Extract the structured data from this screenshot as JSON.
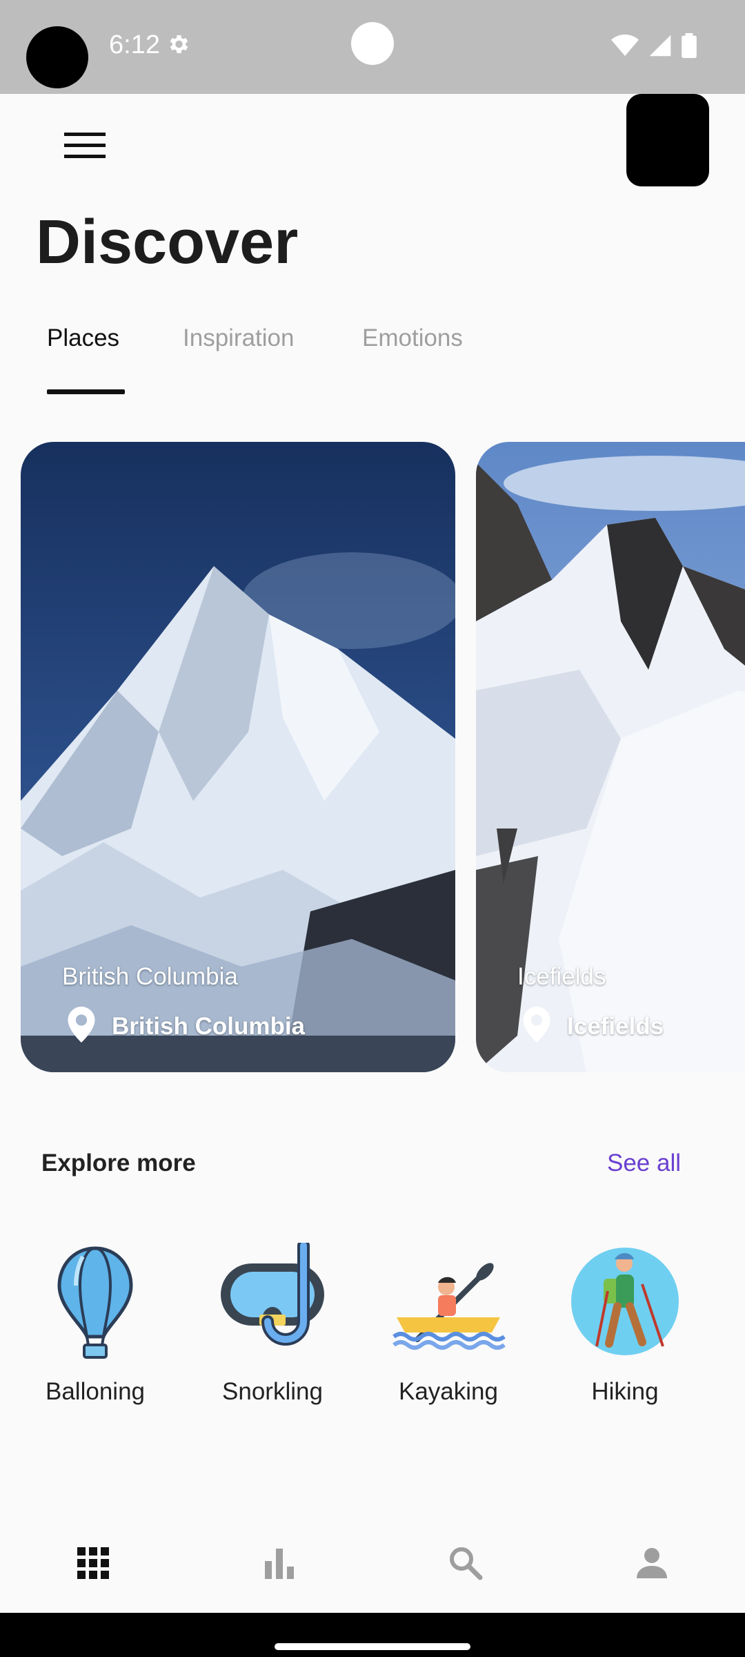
{
  "status_bar": {
    "time": "6:12",
    "icons": [
      "settings-icon",
      "wifi-icon",
      "signal-icon",
      "battery-icon"
    ]
  },
  "header": {
    "title": "Discover",
    "menu_icon": "menu-icon"
  },
  "tabs": [
    {
      "label": "Places",
      "active": true
    },
    {
      "label": "Inspiration",
      "active": false
    },
    {
      "label": "Emotions",
      "active": false
    }
  ],
  "cards": [
    {
      "title": "British Columbia",
      "location": "British Columbia"
    },
    {
      "title": "Icefields",
      "location": "Icefields"
    }
  ],
  "explore": {
    "title": "Explore more",
    "see_all": "See all",
    "items": [
      {
        "label": "Balloning",
        "icon": "hot-air-balloon-icon"
      },
      {
        "label": "Snorkling",
        "icon": "snorkel-mask-icon"
      },
      {
        "label": "Kayaking",
        "icon": "kayak-icon"
      },
      {
        "label": "Hiking",
        "icon": "hiker-icon"
      }
    ]
  },
  "bottom_nav": [
    {
      "icon": "grid-icon",
      "active": true
    },
    {
      "icon": "bar-chart-icon",
      "active": false
    },
    {
      "icon": "search-icon",
      "active": false
    },
    {
      "icon": "person-icon",
      "active": false
    }
  ],
  "colors": {
    "accent": "#6a3fd0",
    "status_bar": "#bdbdbd",
    "background": "#fafafa"
  }
}
